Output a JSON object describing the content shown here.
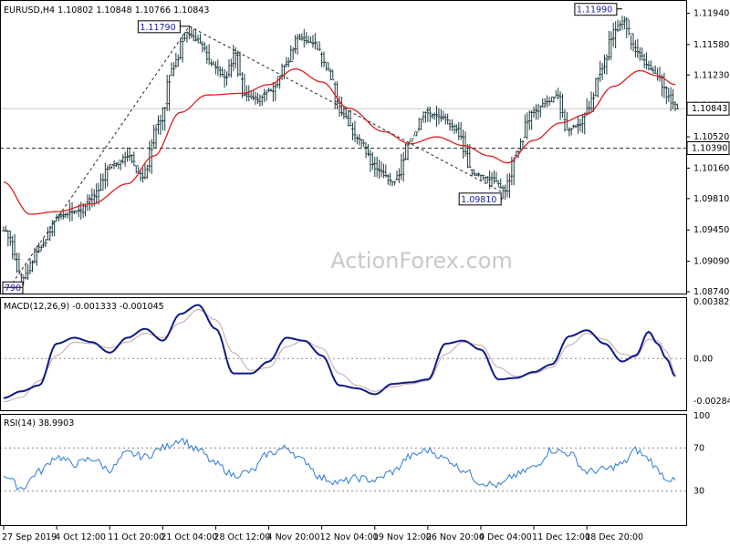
{
  "chart_data": [
    {
      "type": "ohlc",
      "pane": "price",
      "symbol": "EURUSD,H4",
      "last_ohlc": {
        "open": "1.10802",
        "high": "1.10848",
        "low": "1.10766",
        "close": "1.10843"
      },
      "y_ticks": [
        "1.11940",
        "1.11580",
        "1.11230",
        "1.10880",
        "1.10520",
        "1.10160",
        "1.09810",
        "1.09450",
        "1.09090",
        "1.08740"
      ],
      "ylim": [
        1.0874,
        1.1205
      ],
      "current_price": "1.10843",
      "horizontal_level": "1.10390",
      "callouts": [
        {
          "text": "1.11790",
          "value": 1.1179
        },
        {
          "text": "1.11990",
          "value": 1.1199
        },
        {
          "text": "1.09810",
          "value": 1.0981
        },
        {
          "text": "790",
          "value": 1.0879
        }
      ],
      "watermark": "ActionForex.com",
      "anchors": [
        {
          "t": 0,
          "v": 1.0944
        },
        {
          "t": 4,
          "v": 1.089
        },
        {
          "t": 8,
          "v": 1.0925
        },
        {
          "t": 12,
          "v": 1.096
        },
        {
          "t": 17,
          "v": 1.0968
        },
        {
          "t": 20,
          "v": 1.0985
        },
        {
          "t": 24,
          "v": 1.102
        },
        {
          "t": 28,
          "v": 1.103
        },
        {
          "t": 31,
          "v": 1.1005
        },
        {
          "t": 35,
          "v": 1.107
        },
        {
          "t": 38,
          "v": 1.113
        },
        {
          "t": 41,
          "v": 1.1172
        },
        {
          "t": 44,
          "v": 1.116
        },
        {
          "t": 47,
          "v": 1.1135
        },
        {
          "t": 50,
          "v": 1.112
        },
        {
          "t": 52,
          "v": 1.1148
        },
        {
          "t": 54,
          "v": 1.11
        },
        {
          "t": 57,
          "v": 1.1095
        },
        {
          "t": 60,
          "v": 1.1105
        },
        {
          "t": 64,
          "v": 1.1138
        },
        {
          "t": 66,
          "v": 1.1165
        },
        {
          "t": 70,
          "v": 1.116
        },
        {
          "t": 73,
          "v": 1.113
        },
        {
          "t": 76,
          "v": 1.108
        },
        {
          "t": 80,
          "v": 1.105
        },
        {
          "t": 84,
          "v": 1.1015
        },
        {
          "t": 88,
          "v": 1.1
        },
        {
          "t": 92,
          "v": 1.105
        },
        {
          "t": 95,
          "v": 1.108
        },
        {
          "t": 99,
          "v": 1.1075
        },
        {
          "t": 102,
          "v": 1.106
        },
        {
          "t": 106,
          "v": 1.101
        },
        {
          "t": 110,
          "v": 1.1005
        },
        {
          "t": 113,
          "v": 1.099
        },
        {
          "t": 116,
          "v": 1.1035
        },
        {
          "t": 119,
          "v": 1.108
        },
        {
          "t": 122,
          "v": 1.109
        },
        {
          "t": 125,
          "v": 1.11
        },
        {
          "t": 127,
          "v": 1.106
        },
        {
          "t": 130,
          "v": 1.1065
        },
        {
          "t": 132,
          "v": 1.1085
        },
        {
          "t": 135,
          "v": 1.113
        },
        {
          "t": 138,
          "v": 1.1175
        },
        {
          "t": 140,
          "v": 1.1185
        },
        {
          "t": 143,
          "v": 1.115
        },
        {
          "t": 146,
          "v": 1.113
        },
        {
          "t": 148,
          "v": 1.112
        },
        {
          "t": 150,
          "v": 1.1098
        },
        {
          "t": 152,
          "v": 1.1084
        }
      ],
      "sma_anchors": [
        {
          "t": 0,
          "v": 1.1
        },
        {
          "t": 6,
          "v": 1.0963
        },
        {
          "t": 12,
          "v": 1.0966
        },
        {
          "t": 20,
          "v": 1.0975
        },
        {
          "t": 28,
          "v": 1.0998
        },
        {
          "t": 34,
          "v": 1.103
        },
        {
          "t": 40,
          "v": 1.108
        },
        {
          "t": 46,
          "v": 1.11
        },
        {
          "t": 54,
          "v": 1.1102
        },
        {
          "t": 60,
          "v": 1.1112
        },
        {
          "t": 66,
          "v": 1.113
        },
        {
          "t": 72,
          "v": 1.1115
        },
        {
          "t": 78,
          "v": 1.1085
        },
        {
          "t": 86,
          "v": 1.1058
        },
        {
          "t": 92,
          "v": 1.1044
        },
        {
          "t": 98,
          "v": 1.1052
        },
        {
          "t": 104,
          "v": 1.1042
        },
        {
          "t": 110,
          "v": 1.103
        },
        {
          "t": 114,
          "v": 1.1022
        },
        {
          "t": 120,
          "v": 1.1048
        },
        {
          "t": 126,
          "v": 1.1068
        },
        {
          "t": 132,
          "v": 1.1078
        },
        {
          "t": 138,
          "v": 1.111
        },
        {
          "t": 144,
          "v": 1.1128
        },
        {
          "t": 148,
          "v": 1.1122
        },
        {
          "t": 152,
          "v": 1.1112
        }
      ],
      "dashed_lines": [
        [
          {
            "t": 2,
            "v": 1.0884
          },
          {
            "t": 42,
            "v": 1.1179
          }
        ],
        [
          {
            "t": 42,
            "v": 1.1179
          },
          {
            "t": 113,
            "v": 1.0988
          }
        ]
      ]
    },
    {
      "type": "line",
      "pane": "macd",
      "label": "MACD(12,26,9) -0.001333 -0.001045",
      "y_ticks": [
        "0.003826",
        "0.00",
        "-0.002849"
      ],
      "ylim": [
        -0.00335,
        0.004
      ],
      "macd_anchors": [
        {
          "t": 0,
          "v": -0.00265
        },
        {
          "t": 4,
          "v": -0.0022
        },
        {
          "t": 8,
          "v": -0.0018
        },
        {
          "t": 12,
          "v": 0.001
        },
        {
          "t": 16,
          "v": 0.0014
        },
        {
          "t": 20,
          "v": 0.0011
        },
        {
          "t": 24,
          "v": 0.0004
        },
        {
          "t": 28,
          "v": 0.0014
        },
        {
          "t": 32,
          "v": 0.002
        },
        {
          "t": 36,
          "v": 0.0012
        },
        {
          "t": 40,
          "v": 0.003
        },
        {
          "t": 44,
          "v": 0.0036
        },
        {
          "t": 48,
          "v": 0.002
        },
        {
          "t": 52,
          "v": -0.001
        },
        {
          "t": 56,
          "v": -0.001
        },
        {
          "t": 60,
          "v": -0.0002
        },
        {
          "t": 64,
          "v": 0.0014
        },
        {
          "t": 68,
          "v": 0.0012
        },
        {
          "t": 72,
          "v": 0.0002
        },
        {
          "t": 76,
          "v": -0.0018
        },
        {
          "t": 80,
          "v": -0.002
        },
        {
          "t": 84,
          "v": -0.0024
        },
        {
          "t": 88,
          "v": -0.0017
        },
        {
          "t": 92,
          "v": -0.0016
        },
        {
          "t": 96,
          "v": -0.0014
        },
        {
          "t": 100,
          "v": 0.001
        },
        {
          "t": 104,
          "v": 0.0012
        },
        {
          "t": 108,
          "v": 0.0006
        },
        {
          "t": 112,
          "v": -0.0014
        },
        {
          "t": 116,
          "v": -0.0013
        },
        {
          "t": 120,
          "v": -0.0009
        },
        {
          "t": 124,
          "v": -0.0004
        },
        {
          "t": 128,
          "v": 0.0015
        },
        {
          "t": 132,
          "v": 0.0019
        },
        {
          "t": 136,
          "v": 0.001
        },
        {
          "t": 140,
          "v": -0.0002
        },
        {
          "t": 143,
          "v": 0.0002
        },
        {
          "t": 146,
          "v": 0.0018
        },
        {
          "t": 148,
          "v": 0.001
        },
        {
          "t": 150,
          "v": 0.0
        },
        {
          "t": 152,
          "v": -0.0012
        }
      ],
      "signal_anchors": [
        {
          "t": 0,
          "v": -0.0029
        },
        {
          "t": 4,
          "v": -0.0026
        },
        {
          "t": 8,
          "v": -0.0015
        },
        {
          "t": 12,
          "v": 0.0002
        },
        {
          "t": 16,
          "v": 0.0011
        },
        {
          "t": 20,
          "v": 0.001
        },
        {
          "t": 24,
          "v": 0.0007
        },
        {
          "t": 28,
          "v": 0.0011
        },
        {
          "t": 32,
          "v": 0.0017
        },
        {
          "t": 36,
          "v": 0.0014
        },
        {
          "t": 40,
          "v": 0.0024
        },
        {
          "t": 44,
          "v": 0.0033
        },
        {
          "t": 48,
          "v": 0.0026
        },
        {
          "t": 52,
          "v": 0.0004
        },
        {
          "t": 56,
          "v": -0.0008
        },
        {
          "t": 60,
          "v": -0.0006
        },
        {
          "t": 64,
          "v": 0.0008
        },
        {
          "t": 68,
          "v": 0.0012
        },
        {
          "t": 72,
          "v": 0.0007
        },
        {
          "t": 76,
          "v": -0.001
        },
        {
          "t": 80,
          "v": -0.0018
        },
        {
          "t": 84,
          "v": -0.0022
        },
        {
          "t": 88,
          "v": -0.0019
        },
        {
          "t": 92,
          "v": -0.0017
        },
        {
          "t": 96,
          "v": -0.0015
        },
        {
          "t": 100,
          "v": 0.0003
        },
        {
          "t": 104,
          "v": 0.0011
        },
        {
          "t": 108,
          "v": 0.0009
        },
        {
          "t": 112,
          "v": -0.0006
        },
        {
          "t": 116,
          "v": -0.0012
        },
        {
          "t": 120,
          "v": -0.001
        },
        {
          "t": 124,
          "v": -0.0006
        },
        {
          "t": 128,
          "v": 0.0009
        },
        {
          "t": 132,
          "v": 0.0017
        },
        {
          "t": 136,
          "v": 0.0013
        },
        {
          "t": 140,
          "v": 0.0003
        },
        {
          "t": 143,
          "v": 0.0001
        },
        {
          "t": 146,
          "v": 0.0013
        },
        {
          "t": 148,
          "v": 0.0012
        },
        {
          "t": 150,
          "v": 0.0005
        },
        {
          "t": 152,
          "v": -0.001
        }
      ]
    },
    {
      "type": "line",
      "pane": "rsi",
      "label": "RSI(14) 38.9903",
      "y_ticks": [
        "100",
        "70",
        "30"
      ],
      "levels": [
        70,
        30
      ],
      "ylim": [
        0,
        100
      ],
      "rsi_anchors": [
        {
          "t": 0,
          "v": 45
        },
        {
          "t": 4,
          "v": 33
        },
        {
          "t": 8,
          "v": 48
        },
        {
          "t": 12,
          "v": 62
        },
        {
          "t": 16,
          "v": 55
        },
        {
          "t": 20,
          "v": 60
        },
        {
          "t": 24,
          "v": 50
        },
        {
          "t": 28,
          "v": 65
        },
        {
          "t": 32,
          "v": 62
        },
        {
          "t": 36,
          "v": 70
        },
        {
          "t": 40,
          "v": 78
        },
        {
          "t": 44,
          "v": 68
        },
        {
          "t": 48,
          "v": 55
        },
        {
          "t": 52,
          "v": 45
        },
        {
          "t": 56,
          "v": 48
        },
        {
          "t": 60,
          "v": 65
        },
        {
          "t": 64,
          "v": 70
        },
        {
          "t": 68,
          "v": 58
        },
        {
          "t": 72,
          "v": 42
        },
        {
          "t": 76,
          "v": 38
        },
        {
          "t": 80,
          "v": 42
        },
        {
          "t": 84,
          "v": 40
        },
        {
          "t": 88,
          "v": 48
        },
        {
          "t": 92,
          "v": 62
        },
        {
          "t": 96,
          "v": 68
        },
        {
          "t": 100,
          "v": 60
        },
        {
          "t": 104,
          "v": 50
        },
        {
          "t": 108,
          "v": 38
        },
        {
          "t": 112,
          "v": 35
        },
        {
          "t": 116,
          "v": 45
        },
        {
          "t": 120,
          "v": 52
        },
        {
          "t": 124,
          "v": 68
        },
        {
          "t": 128,
          "v": 65
        },
        {
          "t": 132,
          "v": 48
        },
        {
          "t": 136,
          "v": 50
        },
        {
          "t": 140,
          "v": 55
        },
        {
          "t": 143,
          "v": 68
        },
        {
          "t": 146,
          "v": 60
        },
        {
          "t": 148,
          "v": 50
        },
        {
          "t": 150,
          "v": 42
        },
        {
          "t": 152,
          "v": 38.99
        }
      ]
    }
  ],
  "x_axis": {
    "labels": [
      {
        "t": 0,
        "text": "27 Sep 2019"
      },
      {
        "t": 12,
        "text": "4 Oct 12:00"
      },
      {
        "t": 24,
        "text": "11 Oct 20:00"
      },
      {
        "t": 36,
        "text": "21 Oct 04:00"
      },
      {
        "t": 48,
        "text": "28 Oct 12:00"
      },
      {
        "t": 60,
        "text": "4 Nov 20:00"
      },
      {
        "t": 72,
        "text": "12 Nov 04:00"
      },
      {
        "t": 84,
        "text": "19 Nov 12:00"
      },
      {
        "t": 96,
        "text": "26 Nov 20:00"
      },
      {
        "t": 108,
        "text": "4 Dec 04:00"
      },
      {
        "t": 120,
        "text": "11 Dec 12:00"
      },
      {
        "t": 132,
        "text": "18 Dec 20:00"
      }
    ]
  },
  "colors": {
    "bars": "#1d3b40",
    "sma": "#dd1f1f",
    "macd": "#0e1a87",
    "signal": "#c8a4a4",
    "rsi": "#2a7ad8",
    "grid": "#d8d8d8",
    "callout_text": "#1a1aa8",
    "watermark": "#c9c9c9"
  }
}
